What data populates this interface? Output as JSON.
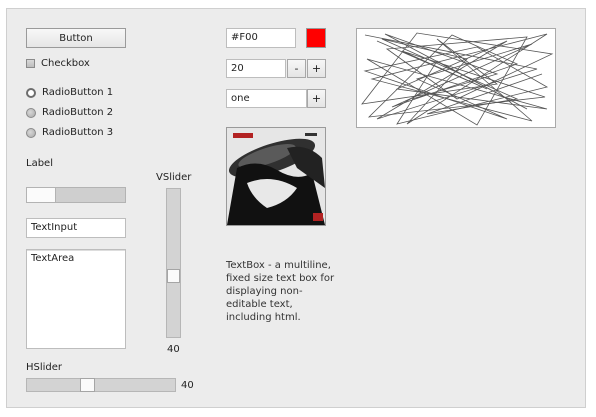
{
  "widgets": {
    "button_label": "Button",
    "checkbox_label": "Checkbox",
    "radios": [
      "RadioButton 1",
      "RadioButton 2",
      "RadioButton 3"
    ],
    "label_text": "Label",
    "progress_fraction": 0.3,
    "text_input_value": "TextInput",
    "text_area_value": "TextArea",
    "hslider_label": "HSlider",
    "hslider_value": "40",
    "vslider_label": "VSlider",
    "vslider_value": "40",
    "color_input_value": "#F00",
    "color_swatch": "#ff0000",
    "number_value": "20",
    "minus_label": "-",
    "plus_label": "+",
    "dropdown_value": "one",
    "dropdown_button_label": "+",
    "textbox_text": "TextBox - a multiline, fixed size text box for displaying non-editable text, including html."
  }
}
